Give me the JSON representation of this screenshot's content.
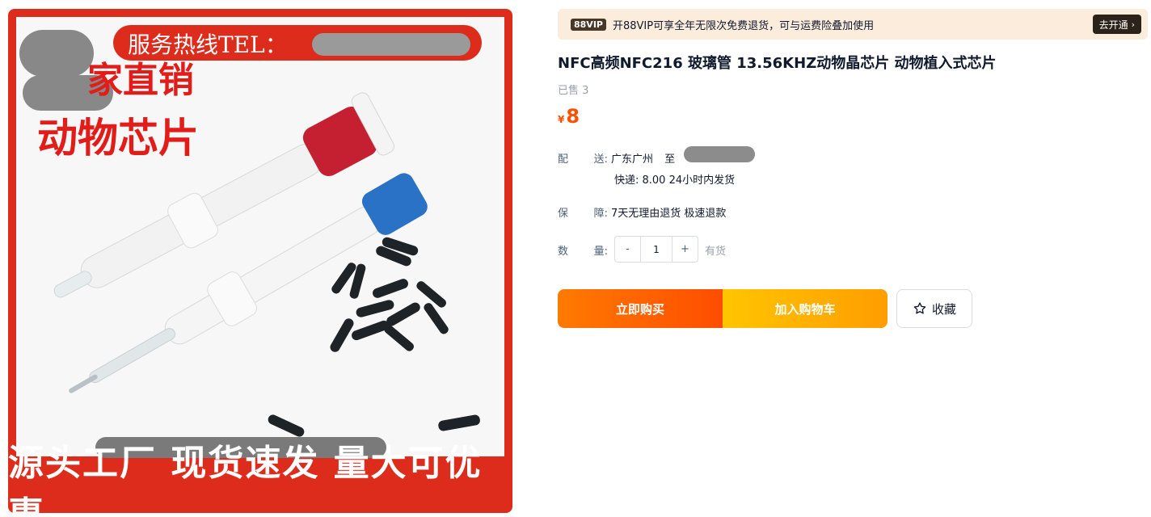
{
  "image": {
    "tel_label": "服务热线TEL：",
    "overlay_line1": "家直销",
    "overlay_line2": "动物芯片",
    "bottom_caption": "源头工厂  现货速发 量大可优惠"
  },
  "vip": {
    "badge": "88VIP",
    "text": "开88VIP可享全年无限次免费退货，可与运费险叠加使用",
    "button": "去开通",
    "button_icon": "chevron-right-icon"
  },
  "product": {
    "title": "NFC高频NFC216 玻璃管   13.56KHZ动物晶芯片   动物植入式芯片",
    "sold": "已售 3",
    "currency": "¥",
    "price": "8"
  },
  "shipping": {
    "label_a": "配",
    "label_b": "送:",
    "origin": "广东广州",
    "to": "至",
    "detail": "快递: 8.00  24小时内发货"
  },
  "guarantee": {
    "label_a": "保",
    "label_b": "障:",
    "value": "7天无理由退货 极速退款"
  },
  "quantity": {
    "label_a": "数",
    "label_b": "量:",
    "minus": "-",
    "value": "1",
    "plus": "+",
    "stock": "有货"
  },
  "actions": {
    "buy": "立即购买",
    "cart": "加入购物车",
    "favorite": "收藏",
    "favorite_icon": "star-outline-icon"
  },
  "colors": {
    "price": "#ff5000",
    "buy_start": "#ff7a00",
    "cart_start": "#ffc500",
    "image_frame": "#dd2b1c"
  }
}
